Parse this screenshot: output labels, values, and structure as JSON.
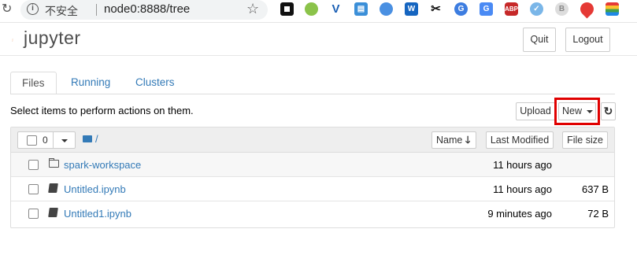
{
  "browser": {
    "insecure_label": "不安全",
    "url": "node0:8888/tree"
  },
  "app": {
    "logo_text": "jupyter",
    "quit_label": "Quit",
    "logout_label": "Logout"
  },
  "tabs": [
    {
      "label": "Files",
      "active": true
    },
    {
      "label": "Running",
      "active": false
    },
    {
      "label": "Clusters",
      "active": false
    }
  ],
  "toolbar": {
    "instructions": "Select items to perform actions on them.",
    "upload_label": "Upload",
    "new_label": "New",
    "highlight_color": "#e00000"
  },
  "list_header": {
    "selected_count": "0",
    "breadcrumb": "/",
    "name_sort_label": "Name",
    "last_modified_label": "Last Modified",
    "file_size_label": "File size"
  },
  "items": [
    {
      "icon": "folder-icon",
      "name": "spark-workspace",
      "modified": "11 hours ago",
      "size": ""
    },
    {
      "icon": "notebook-icon",
      "name": "Untitled.ipynb",
      "modified": "11 hours ago",
      "size": "637 B"
    },
    {
      "icon": "notebook-icon",
      "name": "Untitled1.ipynb",
      "modified": "9 minutes ago",
      "size": "72 B"
    }
  ],
  "colors": {
    "link": "#337ab7",
    "logo_orange": "#f37726"
  }
}
